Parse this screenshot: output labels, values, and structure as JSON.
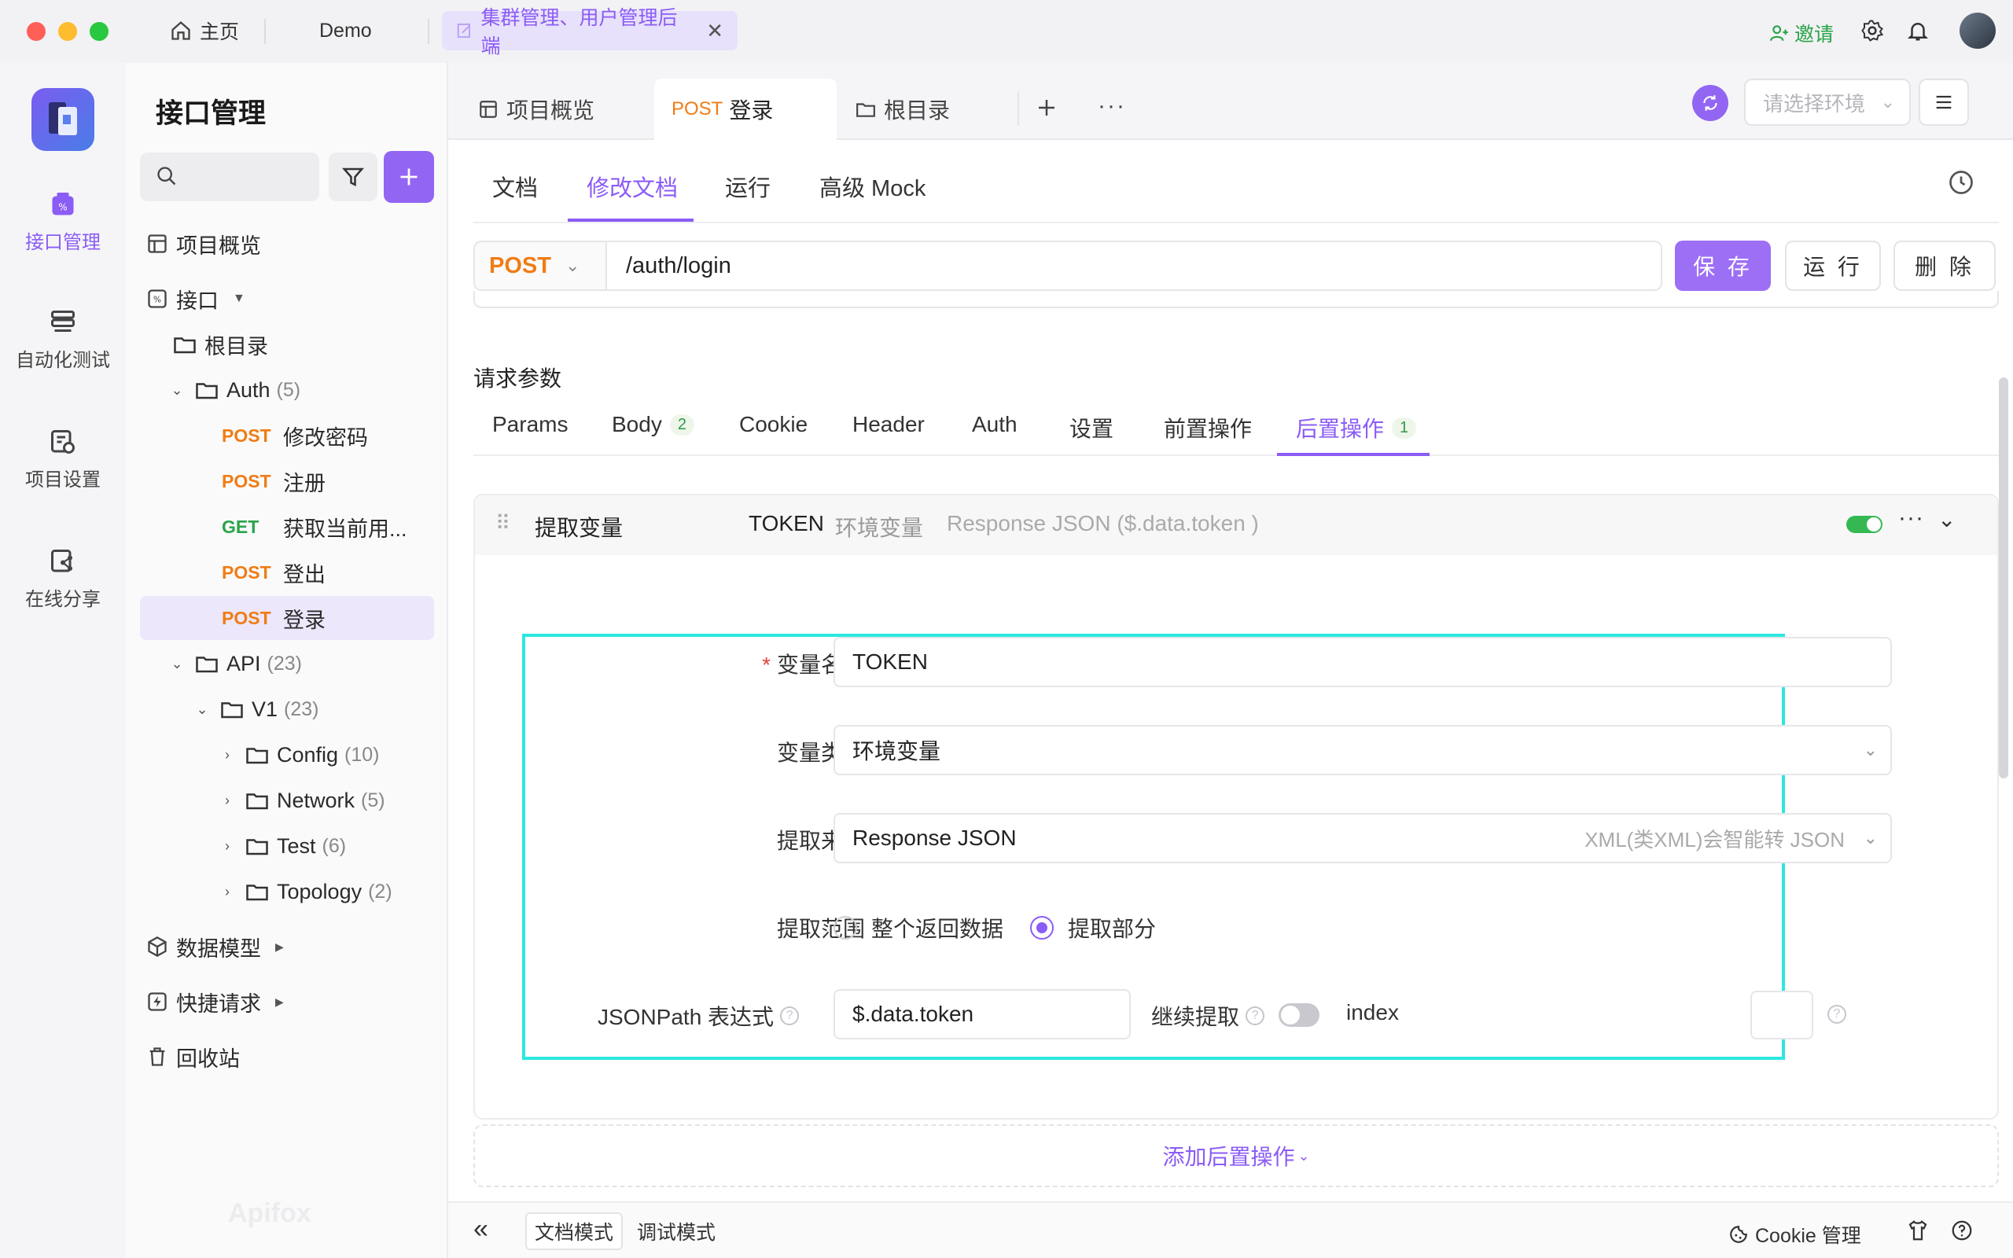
{
  "titlebar": {
    "home": "主页",
    "demo": "Demo",
    "active_tab": "集群管理、用户管理后端",
    "invite": "邀请"
  },
  "rail": {
    "items": [
      "接口管理",
      "自动化测试",
      "项目设置",
      "在线分享"
    ]
  },
  "tree": {
    "title": "接口管理",
    "overview": "项目概览",
    "interfaces": "接口",
    "root": "根目录",
    "auth": {
      "label": "Auth",
      "count": "(5)"
    },
    "auth_items": [
      {
        "method": "POST",
        "label": "修改密码"
      },
      {
        "method": "POST",
        "label": "注册"
      },
      {
        "method": "GET",
        "label": "获取当前用..."
      },
      {
        "method": "POST",
        "label": "登出"
      },
      {
        "method": "POST",
        "label": "登录"
      }
    ],
    "api": {
      "label": "API",
      "count": "(23)"
    },
    "v1": {
      "label": "V1",
      "count": "(23)"
    },
    "v1_children": [
      {
        "label": "Config",
        "count": "(10)"
      },
      {
        "label": "Network",
        "count": "(5)"
      },
      {
        "label": "Test",
        "count": "(6)"
      },
      {
        "label": "Topology",
        "count": "(2)"
      }
    ],
    "data_model": "数据模型",
    "quick_request": "快捷请求",
    "recycle_bin": "回收站",
    "watermark": "Apifox"
  },
  "tabs": {
    "overview": "项目概览",
    "login_method": "POST",
    "login_label": "登录",
    "root": "根目录",
    "env_placeholder": "请选择环境"
  },
  "subtabs": [
    "文档",
    "修改文档",
    "运行",
    "高级 Mock"
  ],
  "request": {
    "method": "POST",
    "url": "/auth/login",
    "save": "保 存",
    "run": "运 行",
    "delete": "删 除",
    "params_title": "请求参数"
  },
  "param_tabs": {
    "params": "Params",
    "body": "Body",
    "body_count": "2",
    "cookie": "Cookie",
    "header": "Header",
    "auth": "Auth",
    "settings": "设置",
    "pre": "前置操作",
    "post": "后置操作",
    "post_count": "1"
  },
  "op": {
    "title": "提取变量",
    "var": "TOKEN",
    "type": "环境变量",
    "source": "Response JSON ($.data.token )",
    "enabled": true
  },
  "form": {
    "var_name_label": "变量名称",
    "var_name": "TOKEN",
    "var_type_label": "变量类型",
    "var_type": "环境变量",
    "source_label": "提取来源",
    "source": "Response JSON",
    "source_hint": "XML(类XML)会智能转 JSON",
    "range_label": "提取范围",
    "range_all": "整个返回数据",
    "range_part": "提取部分",
    "jsonpath_label": "JSONPath 表达式",
    "jsonpath": "$.data.token",
    "continue_label": "继续提取",
    "continue_on": false,
    "index_label": "index"
  },
  "add_op": "添加后置操作",
  "bottom": {
    "doc_mode": "文档模式",
    "debug_mode": "调试模式",
    "cookie_mgr": "Cookie 管理"
  },
  "colors": {
    "accent": "#8b5cf6",
    "post": "#f07c14",
    "get": "#2aa44a",
    "highlight": "#2de8e0"
  }
}
